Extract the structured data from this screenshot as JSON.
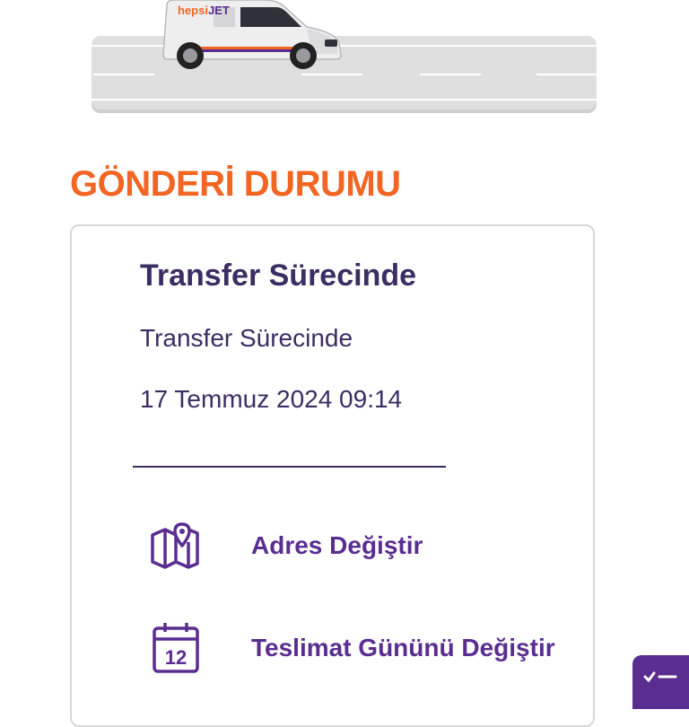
{
  "banner": {
    "brand_logo": {
      "part1": "hepsi",
      "part2": "JET"
    }
  },
  "page_title": "GÖNDERİ DURUMU",
  "status": {
    "title": "Transfer Sürecinde",
    "description": "Transfer Sürecinde",
    "date": "17 Temmuz 2024 09:14"
  },
  "actions": [
    {
      "label": "Adres Değiştir",
      "icon": "map-pin-icon"
    },
    {
      "label": "Teslimat Gününü Değiştir",
      "icon": "calendar-icon",
      "icon_text": "12"
    }
  ],
  "fab": {
    "icon": "checklist-icon"
  },
  "colors": {
    "accent_orange": "#f26522",
    "primary_purple": "#5a2d91",
    "text_dark": "#3c2d63"
  }
}
